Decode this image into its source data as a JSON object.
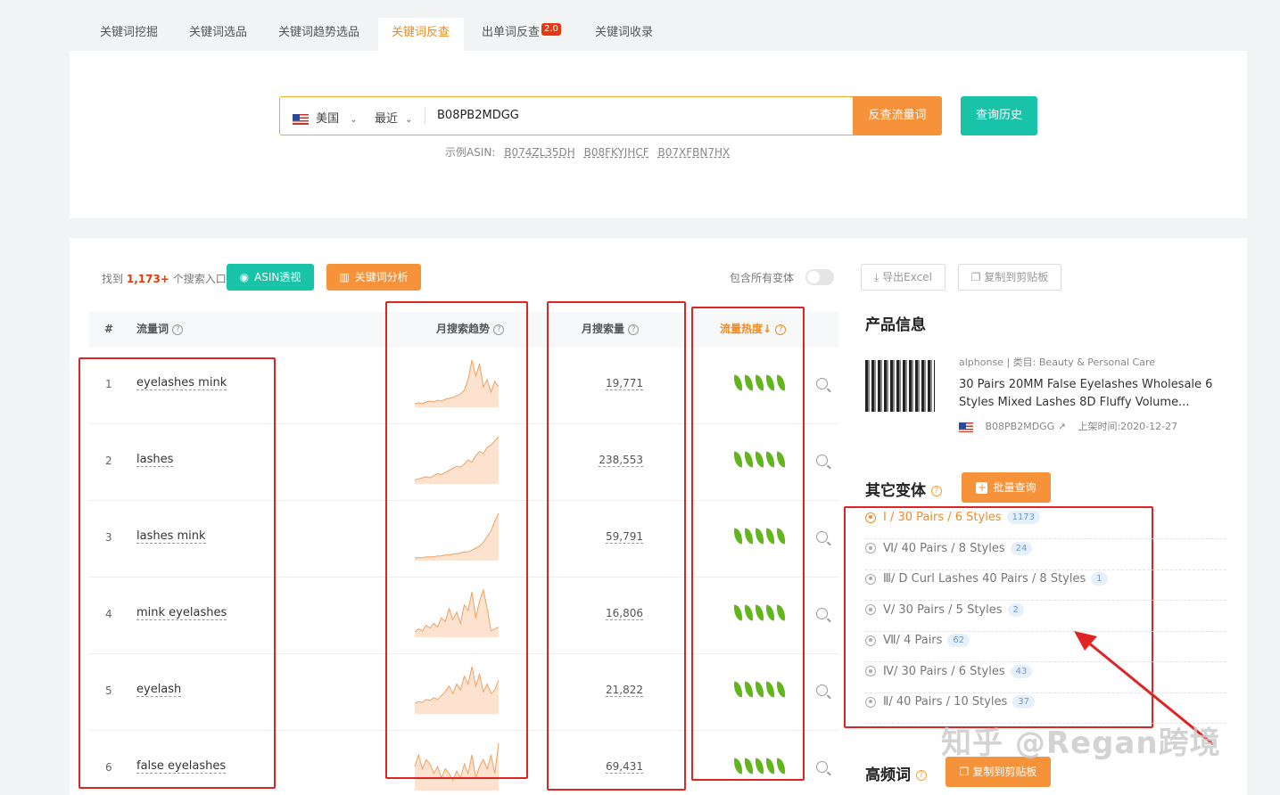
{
  "tabs": [
    {
      "label": "关键词挖掘"
    },
    {
      "label": "关键词选品"
    },
    {
      "label": "关键词趋势选品"
    },
    {
      "label": "关键词反查"
    },
    {
      "label": "出单词反查",
      "badge": "2.0"
    },
    {
      "label": "关键词收录"
    }
  ],
  "search": {
    "country": "美国",
    "period": "最近",
    "value": "B08PB2MDGG",
    "submit_label": "反查流量词",
    "history_label": "查询历史",
    "example_label": "示例ASIN:",
    "examples": [
      "B074ZL35DH",
      "B08FKYJHCF",
      "B07XFBN7HX"
    ]
  },
  "summary": {
    "prefix": "找到",
    "count": "1,173+",
    "suffix": "个搜索入口",
    "asin_btn": "ASIN透视",
    "kw_btn": "关键词分析",
    "variant_toggle_label": "包含所有变体",
    "export_label": "导出Excel",
    "copy_label": "复制到剪贴板"
  },
  "table": {
    "headers": {
      "num": "#",
      "keyword": "流量词",
      "trend": "月搜索趋势",
      "volume": "月搜索量",
      "heat": "流量热度"
    },
    "rows": [
      {
        "num": "1",
        "keyword": "eyelashes mink",
        "volume": "19,771",
        "heat": 5,
        "trend": [
          3,
          4,
          3,
          5,
          6,
          5,
          7,
          6,
          8,
          9,
          10,
          12,
          14,
          18,
          30,
          52,
          34,
          48,
          22,
          30,
          16,
          28,
          22
        ]
      },
      {
        "num": "2",
        "keyword": "lashes",
        "volume": "238,553",
        "heat": 5,
        "trend": [
          3,
          4,
          5,
          6,
          5,
          7,
          9,
          8,
          10,
          12,
          14,
          16,
          15,
          18,
          22,
          20,
          26,
          30,
          28,
          34,
          36,
          40,
          44
        ]
      },
      {
        "num": "3",
        "keyword": "lashes mink",
        "volume": "59,791",
        "heat": 5,
        "trend": [
          2,
          2,
          2,
          3,
          3,
          3,
          4,
          4,
          5,
          5,
          6,
          6,
          7,
          8,
          8,
          10,
          12,
          14,
          18,
          24,
          30,
          40,
          48
        ]
      },
      {
        "num": "4",
        "keyword": "mink eyelashes",
        "volume": "16,806",
        "heat": 5,
        "trend": [
          5,
          8,
          6,
          12,
          9,
          14,
          10,
          20,
          16,
          30,
          18,
          26,
          14,
          34,
          28,
          48,
          20,
          38,
          50,
          30,
          6,
          8,
          10
        ]
      },
      {
        "num": "5",
        "keyword": "eyelash",
        "volume": "21,822",
        "heat": 5,
        "trend": [
          10,
          12,
          11,
          14,
          13,
          16,
          14,
          18,
          22,
          28,
          20,
          30,
          24,
          38,
          30,
          48,
          28,
          40,
          22,
          30,
          20,
          24,
          34
        ]
      },
      {
        "num": "6",
        "keyword": "false eyelashes",
        "volume": "69,431",
        "heat": 5,
        "trend": [
          20,
          30,
          18,
          26,
          22,
          14,
          20,
          10,
          18,
          14,
          8,
          16,
          10,
          22,
          14,
          30,
          10,
          20,
          26,
          18,
          30,
          14,
          40
        ]
      }
    ]
  },
  "product": {
    "heading": "产品信息",
    "brand": "alphonse",
    "category_label": "类目:",
    "category": "Beauty & Personal Care",
    "title": "30 Pairs 20MM False Eyelashes Wholesale 6 Styles Mixed Lashes 8D Fluffy Volume...",
    "asin": "B08PB2MDGG",
    "date_label": "上架时间:",
    "date": "2020-12-27"
  },
  "variants": {
    "heading": "其它变体",
    "batch_label": "批量查询",
    "items": [
      {
        "label": "Ⅰ / 30 Pairs / 6 Styles",
        "count": "1173",
        "selected": true
      },
      {
        "label": "Ⅵ/ 40 Pairs / 8 Styles",
        "count": "24"
      },
      {
        "label": "Ⅲ/ D Curl Lashes 40 Pairs / 8 Styles",
        "count": "1"
      },
      {
        "label": "Ⅴ/ 30 Pairs / 5 Styles",
        "count": "2"
      },
      {
        "label": "Ⅶ/ 4 Pairs",
        "count": "62"
      },
      {
        "label": "Ⅳ/ 30 Pairs / 6 Styles",
        "count": "43"
      },
      {
        "label": "Ⅱ/ 40 Pairs / 10 Styles",
        "count": "37"
      }
    ]
  },
  "high_freq": {
    "heading": "高频词",
    "copy_label": "复制到剪贴板"
  },
  "watermark": "知乎 @Regan跨境",
  "colors": {
    "accent": "#f08a24",
    "teal": "#19c3a8",
    "annotation": "#e02424",
    "leaf": "#62b51d"
  }
}
